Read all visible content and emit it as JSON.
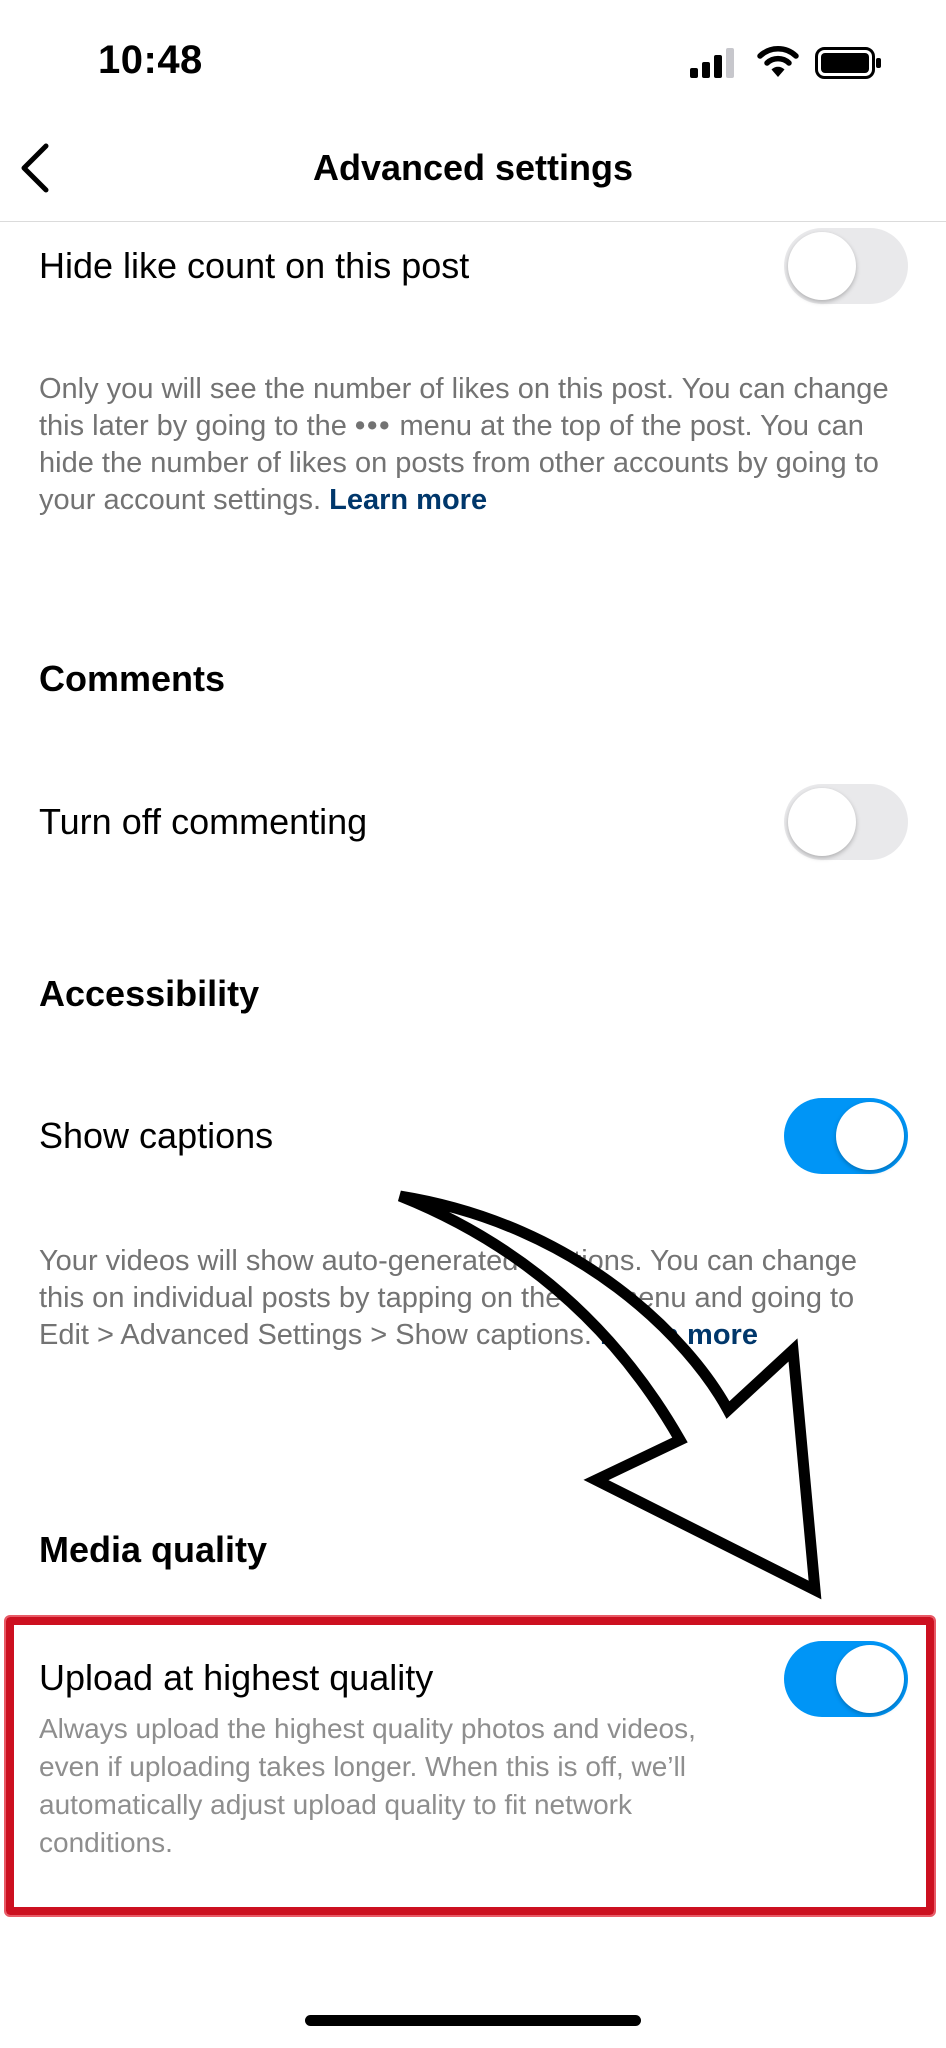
{
  "status_bar": {
    "time": "10:48"
  },
  "header": {
    "title": "Advanced settings"
  },
  "like_count": {
    "label": "Hide like count on this post",
    "enabled": false,
    "desc_before_dots": "Only you will see the number of likes on this post. You can change this later by going to the ",
    "dots": "•••",
    "desc_after_dots": " menu at the top of the post. You can hide the number of likes on posts from other accounts by going to your account settings. ",
    "learn_more": "Learn more"
  },
  "comments": {
    "section_title": "Comments",
    "label": "Turn off commenting",
    "enabled": false
  },
  "accessibility": {
    "section_title": "Accessibility",
    "label": "Show captions",
    "enabled": true,
    "desc_before_dots": "Your videos will show auto-generated captions. You can change this on individual posts by tapping on the ",
    "dots": "•••",
    "desc_after_dots": " menu and going to Edit > Advanced Settings > Show captions. ",
    "learn_more": "Learn more"
  },
  "media_quality": {
    "section_title": "Media quality",
    "label": "Upload at highest quality",
    "enabled": true,
    "desc": "Always upload the highest quality photos and videos, even if uploading takes longer. When this is off, we’ll automatically adjust upload quality to fit network conditions."
  },
  "colors": {
    "toggle_on": "#0095f6",
    "toggle_off": "#e9e9eb",
    "link": "#00376b",
    "highlight": "#cc1020"
  }
}
